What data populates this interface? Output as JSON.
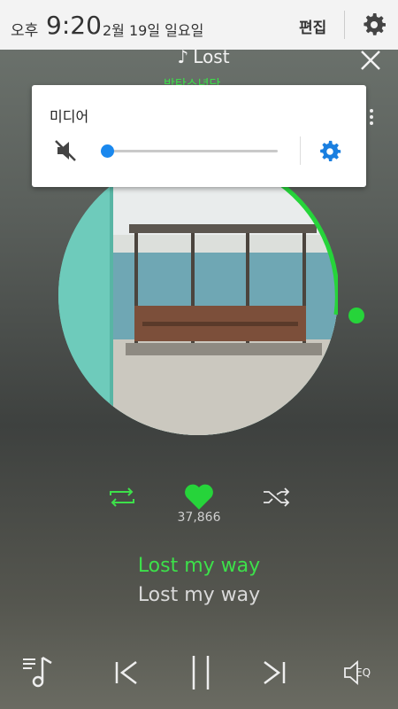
{
  "status": {
    "ampm": "오후",
    "time": "9:20",
    "date": "2월 19일 일요일",
    "edit_label": "편집",
    "settings_icon": "gear-icon"
  },
  "track": {
    "title": "Lost",
    "artist": "방탄소년단"
  },
  "volume_panel": {
    "label": "미디어",
    "level": 0.0,
    "muted": true,
    "accent": "#1a88ee"
  },
  "player": {
    "likes": "37,866",
    "accent": "#3de04a",
    "progress": 0.32
  },
  "lyrics": {
    "current": "Lost my way",
    "next": "Lost my way"
  },
  "controls": {
    "eq_label": "EQ"
  }
}
